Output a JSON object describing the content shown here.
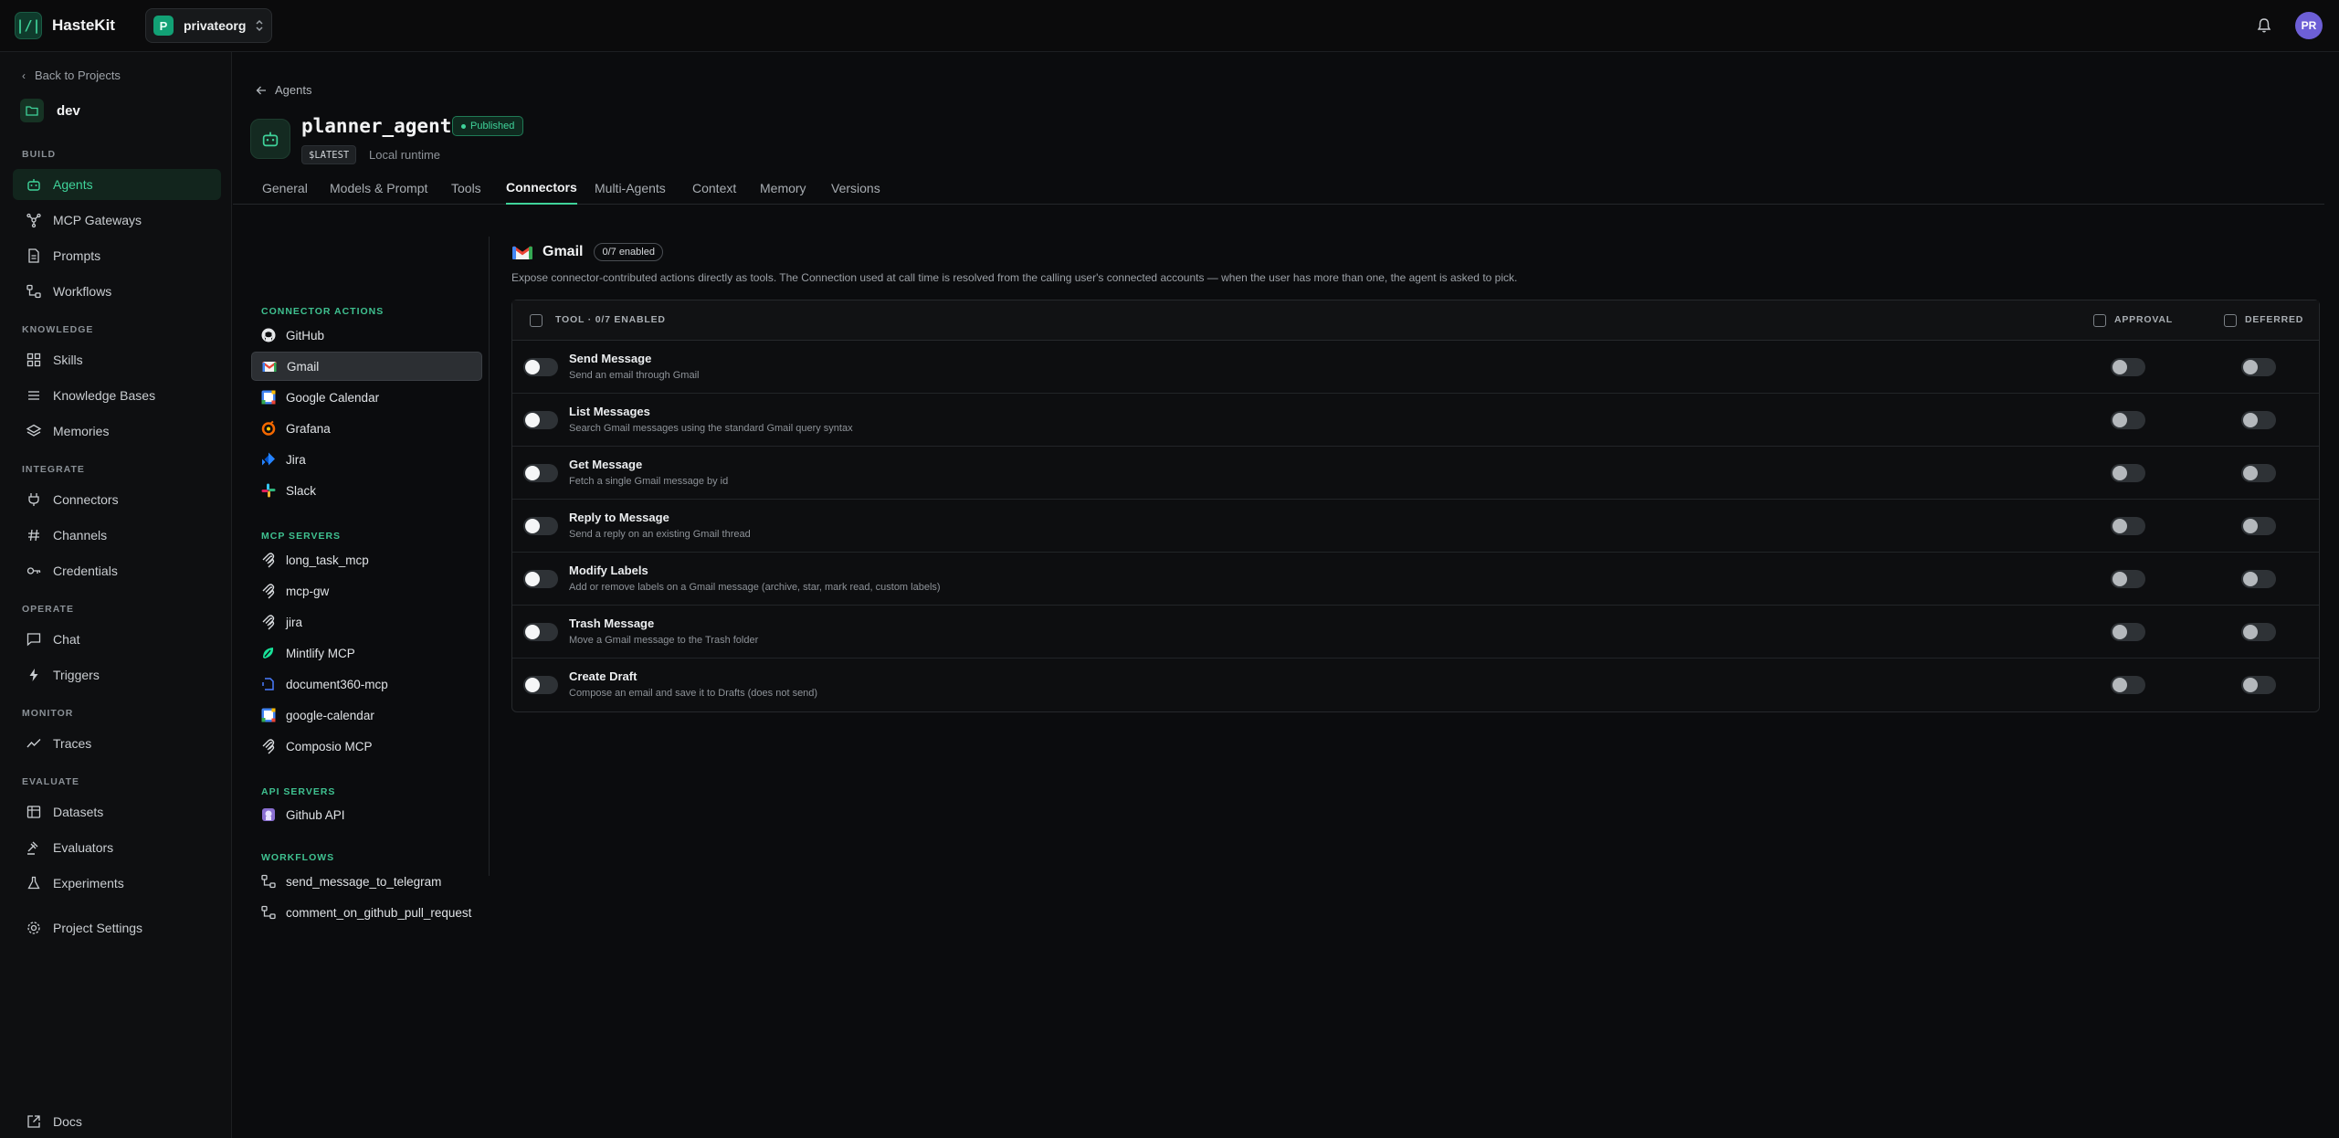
{
  "app": {
    "name": "HasteKit",
    "logo_glyph": "|/|",
    "org": {
      "avatar_letter": "P",
      "name": "privateorg"
    },
    "user_initials": "PR"
  },
  "sidebar": {
    "back_label": "Back to Projects",
    "project_name": "dev",
    "sections": {
      "build": "BUILD",
      "knowledge": "KNOWLEDGE",
      "integrate": "INTEGRATE",
      "operate": "OPERATE",
      "monitor": "MONITOR",
      "evaluate": "EVALUATE"
    },
    "items": {
      "agents": "Agents",
      "mcp_gateways": "MCP Gateways",
      "prompts": "Prompts",
      "workflows": "Workflows",
      "skills": "Skills",
      "knowledge_bases": "Knowledge Bases",
      "memories": "Memories",
      "connectors": "Connectors",
      "channels": "Channels",
      "credentials": "Credentials",
      "chat": "Chat",
      "triggers": "Triggers",
      "traces": "Traces",
      "datasets": "Datasets",
      "evaluators": "Evaluators",
      "experiments": "Experiments",
      "project_settings": "Project Settings",
      "docs": "Docs"
    }
  },
  "agent": {
    "breadcrumb": "Agents",
    "name": "planner_agent",
    "status": "Published",
    "version": "$LATEST",
    "runtime": "Local runtime"
  },
  "tabs": {
    "general": "General",
    "models_prompt": "Models & Prompt",
    "tools": "Tools",
    "connectors": "Connectors",
    "multi_agents": "Multi-Agents",
    "context": "Context",
    "memory": "Memory",
    "versions": "Versions"
  },
  "connectors": {
    "sections": {
      "actions": "CONNECTOR ACTIONS",
      "mcp": "MCP SERVERS",
      "api": "API SERVERS",
      "workflows": "WORKFLOWS"
    },
    "actions": [
      "GitHub",
      "Gmail",
      "Google Calendar",
      "Grafana",
      "Jira",
      "Slack"
    ],
    "mcp_servers": [
      "long_task_mcp",
      "mcp-gw",
      "jira",
      "Mintlify MCP",
      "document360-mcp",
      "google-calendar",
      "Composio MCP"
    ],
    "api_servers": [
      "Github API"
    ],
    "workflows": [
      "send_message_to_telegram",
      "comment_on_github_pull_request"
    ]
  },
  "detail": {
    "title": "Gmail",
    "enabled_badge": "0/7 enabled",
    "description": "Expose connector-contributed actions directly as tools. The Connection used at call time is resolved from the calling user's connected accounts — when the user has more than one, the agent is asked to pick.",
    "header": {
      "tool": "TOOL · 0/7 ENABLED",
      "approval": "APPROVAL",
      "deferred": "DEFERRED"
    },
    "tools": [
      {
        "name": "Send Message",
        "desc": "Send an email through Gmail"
      },
      {
        "name": "List Messages",
        "desc": "Search Gmail messages using the standard Gmail query syntax"
      },
      {
        "name": "Get Message",
        "desc": "Fetch a single Gmail message by id"
      },
      {
        "name": "Reply to Message",
        "desc": "Send a reply on an existing Gmail thread"
      },
      {
        "name": "Modify Labels",
        "desc": "Add or remove labels on a Gmail message (archive, star, mark read, custom labels)"
      },
      {
        "name": "Trash Message",
        "desc": "Move a Gmail message to the Trash folder"
      },
      {
        "name": "Create Draft",
        "desc": "Compose an email and save it to Drafts (does not send)"
      }
    ]
  },
  "colors": {
    "accent": "#3fd39a",
    "background": "#0b0c0e",
    "sidebar_active_bg": "#12251d",
    "user_avatar": "#6d5fd6"
  }
}
